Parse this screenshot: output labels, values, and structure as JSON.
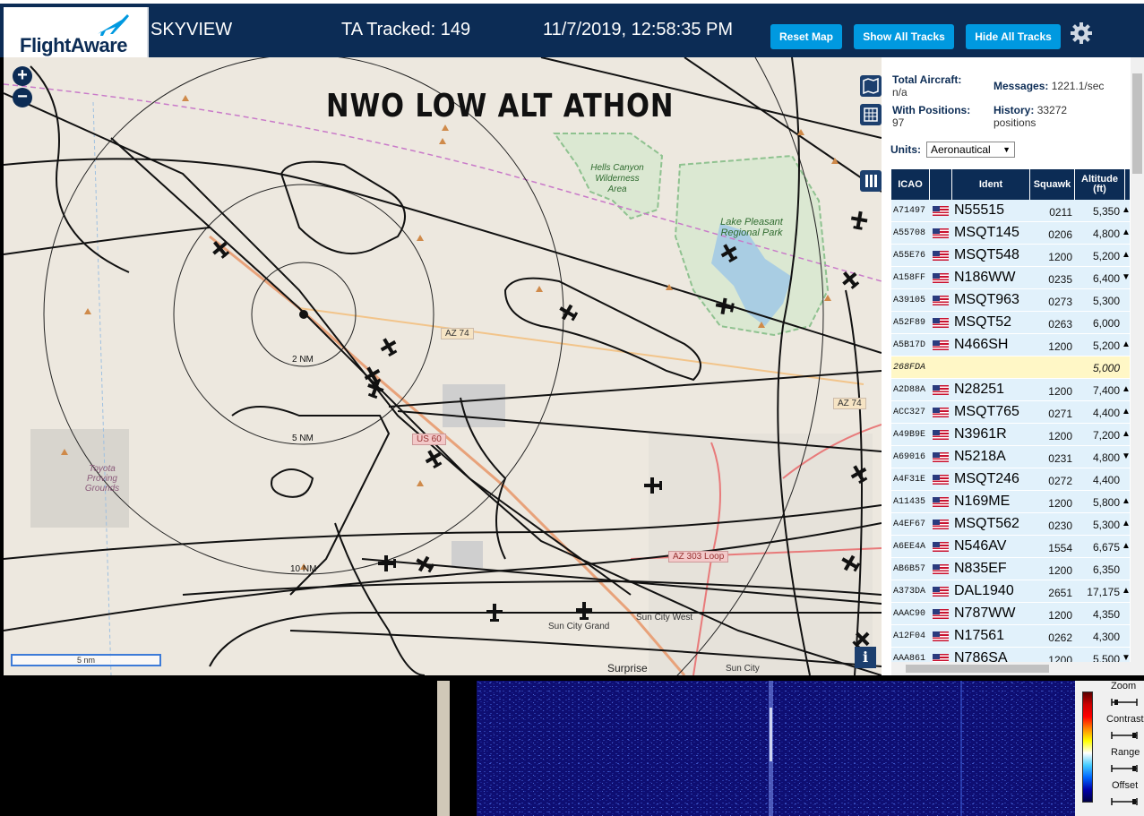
{
  "header": {
    "logo_text": "FlightAware",
    "app_name": "SKYVIEW",
    "tracked": "TA Tracked: 149",
    "datetime": "11/7/2019, 12:58:35 PM",
    "buttons": {
      "reset": "Reset Map",
      "show": "Show All Tracks",
      "hide": "Hide All Tracks"
    }
  },
  "map": {
    "title": "NWO LOW ALT ATHON",
    "zoom_in": "+",
    "zoom_out": "−",
    "scale": "5 nm",
    "info": "i",
    "labels": {
      "hells_canyon": "Hells Canyon Wilderness Area",
      "lake_pleasant": "Lake Pleasant Regional Park",
      "toyota": "Toyota Proving Grounds",
      "ring_2": "2 NM",
      "ring_5": "5 NM",
      "ring_10": "10 NM",
      "az74_a": "AZ 74",
      "az74_b": "AZ 74",
      "us60": "US 60",
      "az303": "AZ 303 Loop",
      "sun_city_grand": "Sun City Grand",
      "sun_city_west": "Sun City West",
      "surprise": "Surprise",
      "sun_city": "Sun City"
    }
  },
  "stats": {
    "total_label": "Total Aircraft:",
    "total_value": "n/a",
    "positions_label": "With Positions:",
    "positions_value": "97",
    "messages_label": "Messages:",
    "messages_value": "1221.1/sec",
    "history_label": "History:",
    "history_value": "33272",
    "history_unit": "positions"
  },
  "units": {
    "label": "Units:",
    "selected": "Aeronautical"
  },
  "table": {
    "headers": [
      "ICAO",
      "",
      "Ident",
      "Squawk",
      "Altitude (ft)"
    ],
    "rows": [
      {
        "icao": "A71497",
        "ident": "N55515",
        "squawk": "0211",
        "alt": "5,350",
        "trend": "▲"
      },
      {
        "icao": "A55708",
        "ident": "MSQT145",
        "squawk": "0206",
        "alt": "4,800",
        "trend": "▲"
      },
      {
        "icao": "A55E76",
        "ident": "MSQT548",
        "squawk": "1200",
        "alt": "5,200",
        "trend": "▲"
      },
      {
        "icao": "A158FF",
        "ident": "N186WW",
        "squawk": "0235",
        "alt": "6,400",
        "trend": "▼"
      },
      {
        "icao": "A39105",
        "ident": "MSQT963",
        "squawk": "0273",
        "alt": "5,300",
        "trend": ""
      },
      {
        "icao": "A52F89",
        "ident": "MSQT52",
        "squawk": "0263",
        "alt": "6,000",
        "trend": ""
      },
      {
        "icao": "A5B17D",
        "ident": "N466SH",
        "squawk": "1200",
        "alt": "5,200",
        "trend": "▲"
      },
      {
        "icao": "268FDA",
        "ident": "",
        "squawk": "",
        "alt": "5,000",
        "trend": ""
      },
      {
        "icao": "A2D88A",
        "ident": "N28251",
        "squawk": "1200",
        "alt": "7,400",
        "trend": "▲"
      },
      {
        "icao": "ACC327",
        "ident": "MSQT765",
        "squawk": "0271",
        "alt": "4,400",
        "trend": "▲"
      },
      {
        "icao": "A49B9E",
        "ident": "N3961R",
        "squawk": "1200",
        "alt": "7,200",
        "trend": "▲"
      },
      {
        "icao": "A69016",
        "ident": "N5218A",
        "squawk": "0231",
        "alt": "4,800",
        "trend": "▼"
      },
      {
        "icao": "A4F31E",
        "ident": "MSQT246",
        "squawk": "0272",
        "alt": "4,400",
        "trend": ""
      },
      {
        "icao": "A11435",
        "ident": "N169ME",
        "squawk": "1200",
        "alt": "5,800",
        "trend": "▲"
      },
      {
        "icao": "A4EF67",
        "ident": "MSQT562",
        "squawk": "0230",
        "alt": "5,300",
        "trend": "▲"
      },
      {
        "icao": "A6EE4A",
        "ident": "N546AV",
        "squawk": "1554",
        "alt": "6,675",
        "trend": "▲"
      },
      {
        "icao": "AB6B57",
        "ident": "N835EF",
        "squawk": "1200",
        "alt": "6,350",
        "trend": ""
      },
      {
        "icao": "A373DA",
        "ident": "DAL1940",
        "squawk": "2651",
        "alt": "17,175",
        "trend": "▲"
      },
      {
        "icao": "AAAC90",
        "ident": "N787WW",
        "squawk": "1200",
        "alt": "4,350",
        "trend": ""
      },
      {
        "icao": "A12F04",
        "ident": "N17561",
        "squawk": "0262",
        "alt": "4,300",
        "trend": ""
      },
      {
        "icao": "AAA861",
        "ident": "N786SA",
        "squawk": "1200",
        "alt": "5,500",
        "trend": "▼"
      }
    ]
  },
  "spectrum": {
    "controls": [
      "Zoom",
      "Contrast",
      "Range",
      "Offset"
    ]
  },
  "colors": {
    "brand": "#0c2c55",
    "button": "#0099e0",
    "row": "#e1f1fb",
    "highlight": "#fff7c6"
  }
}
